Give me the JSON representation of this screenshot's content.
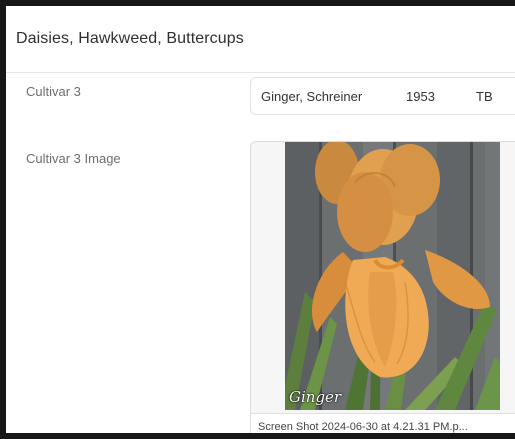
{
  "section": {
    "title": "Daisies, Hawkweed, Buttercups"
  },
  "fields": {
    "cultivar": {
      "label": "Cultivar 3",
      "name": "Ginger, Schreiner",
      "year": "1953",
      "type": "TB"
    },
    "image": {
      "label": "Cultivar 3 Image",
      "caption": "Ginger",
      "filename": "Screen Shot 2024-06-30 at 4.21.31 PM.p..."
    }
  }
}
